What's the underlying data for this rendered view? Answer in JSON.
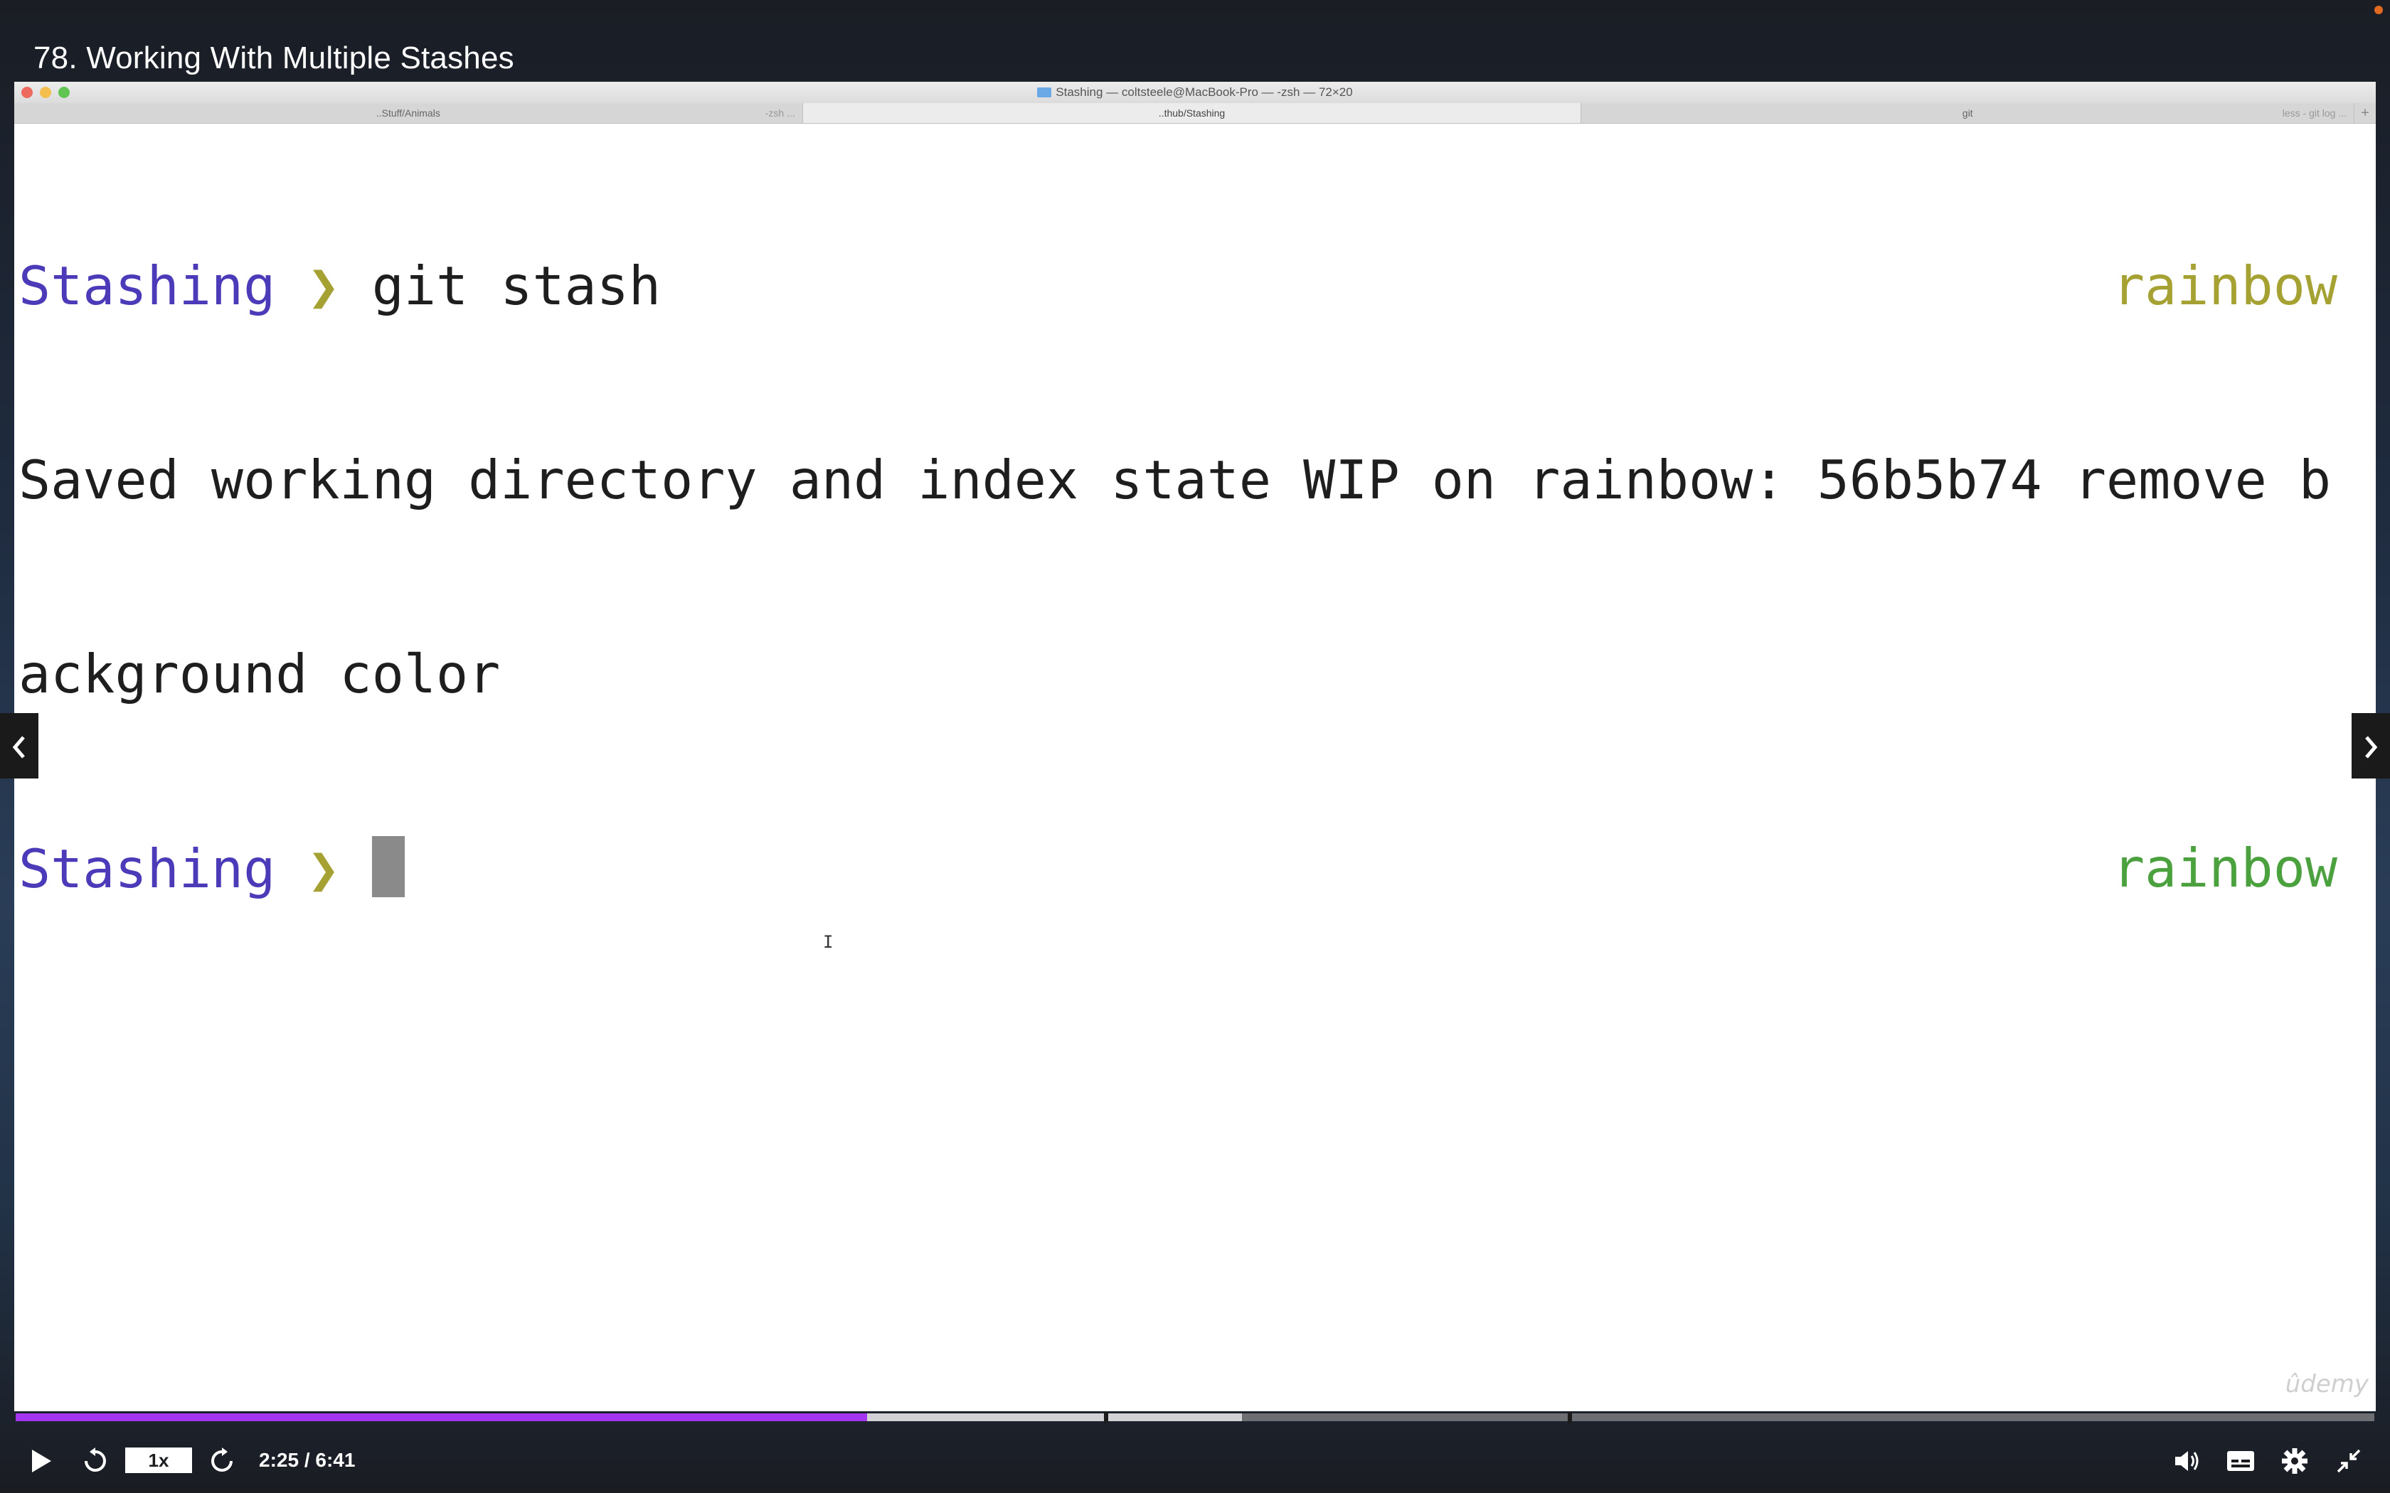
{
  "video": {
    "title": "78. Working With Multiple Stashes",
    "current_time": "2:25",
    "duration": "6:41",
    "time_display": "2:25 / 6:41",
    "speed": "1x",
    "progress_fraction": 0.361,
    "buffer_fraction": 0.52,
    "watermark": "ûdemy"
  },
  "terminal_window": {
    "title": "Stashing — coltsteele@MacBook-Pro — -zsh — 72×20",
    "tabs": [
      {
        "label": "..Stuff/Animals",
        "sub": "-zsh ..."
      },
      {
        "label": "..thub/Stashing",
        "sub": ""
      },
      {
        "label": "git",
        "sub": "less - git log ..."
      }
    ],
    "lines": {
      "l1_dir": "Stashing",
      "l1_arrow": "❯",
      "l1_cmd": "git stash",
      "l1_branch": "rainbow",
      "l2": "Saved working directory and index state WIP on rainbow: 56b5b74 remove b",
      "l3": "ackground color",
      "l4_dir": "Stashing",
      "l4_arrow": "❯",
      "l4_branch": "rainbow"
    }
  },
  "colors": {
    "accent_progress": "#a435f0",
    "prompt_dir": "#4b3bb8",
    "prompt_arrow": "#a5a133",
    "branch_dirty": "#a5a133",
    "branch_clean": "#4aa13e"
  }
}
